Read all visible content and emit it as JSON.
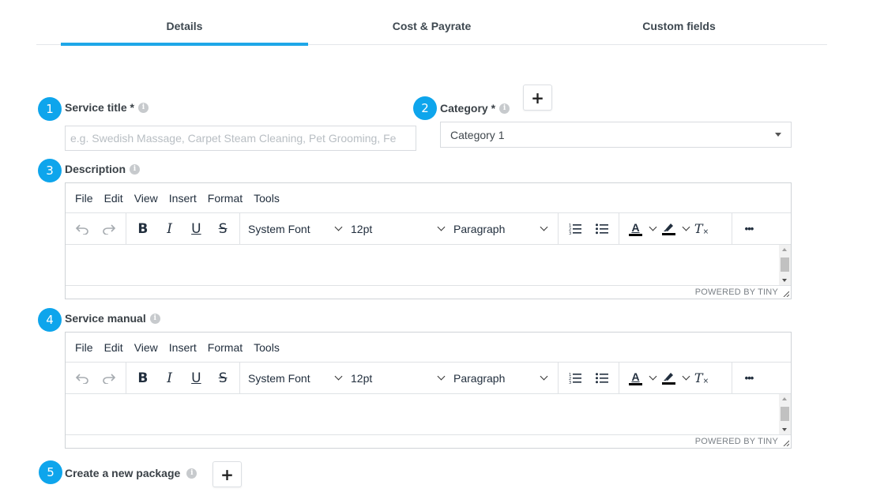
{
  "tabs": [
    {
      "label": "Details",
      "active": true
    },
    {
      "label": "Cost & Payrate",
      "active": false
    },
    {
      "label": "Custom fields",
      "active": false
    }
  ],
  "colors": {
    "accent": "#1ea7e8",
    "badge": "#0ea5ec",
    "info_icon": "#c7cacd"
  },
  "form": {
    "service_title": {
      "step": "1",
      "label": "Service title *",
      "placeholder": "e.g. Swedish Massage, Carpet Steam Cleaning, Pet Grooming, Fe",
      "value": ""
    },
    "category": {
      "step": "2",
      "label": "Category *",
      "selected": "Category 1",
      "add_label": "+"
    },
    "description": {
      "step": "3",
      "label": "Description"
    },
    "service_manual": {
      "step": "4",
      "label": "Service manual"
    },
    "package": {
      "step": "5",
      "label": "Create a new package",
      "add_label": "+"
    }
  },
  "editor": {
    "menu": [
      "File",
      "Edit",
      "View",
      "Insert",
      "Format",
      "Tools"
    ],
    "font_family": "System Font",
    "font_size": "12pt",
    "block_format": "Paragraph",
    "bold": "B",
    "italic": "I",
    "underline": "U",
    "strike": "S",
    "text_color": "A",
    "clear_format": "T",
    "more": "•••",
    "powered_by": "POWERED BY TINY",
    "icons": [
      "undo-icon",
      "redo-icon",
      "numbered-list-icon",
      "bullet-list-icon",
      "highlighter-icon",
      "resize-handle-icon"
    ]
  }
}
